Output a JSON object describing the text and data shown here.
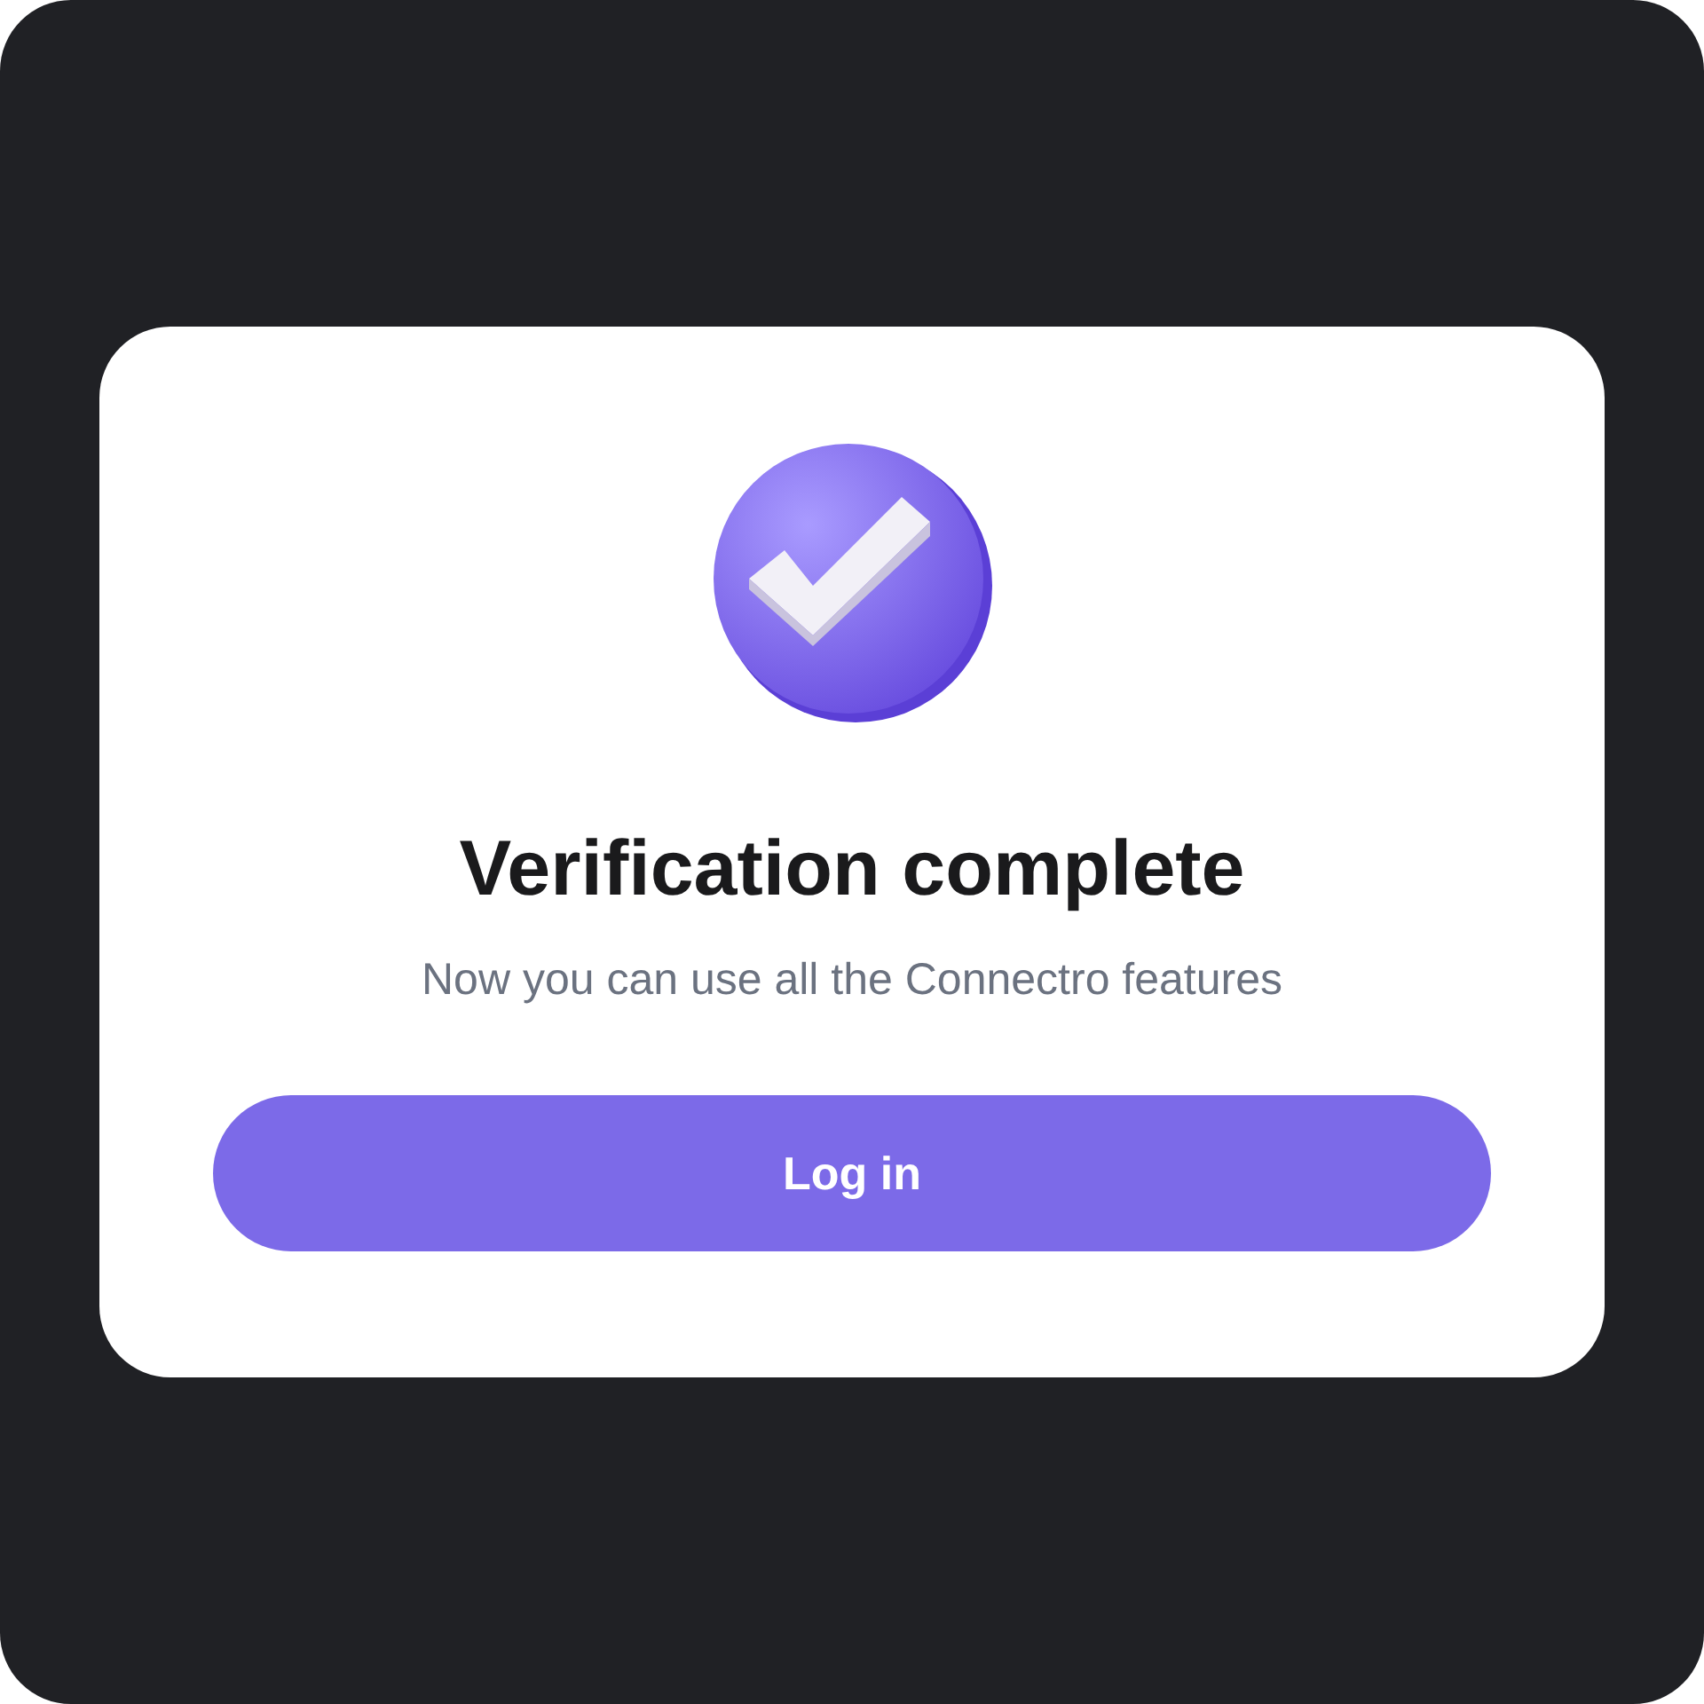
{
  "dialog": {
    "title": "Verification complete",
    "message": "Now you can use all the Connectro features",
    "button": "Log in"
  }
}
